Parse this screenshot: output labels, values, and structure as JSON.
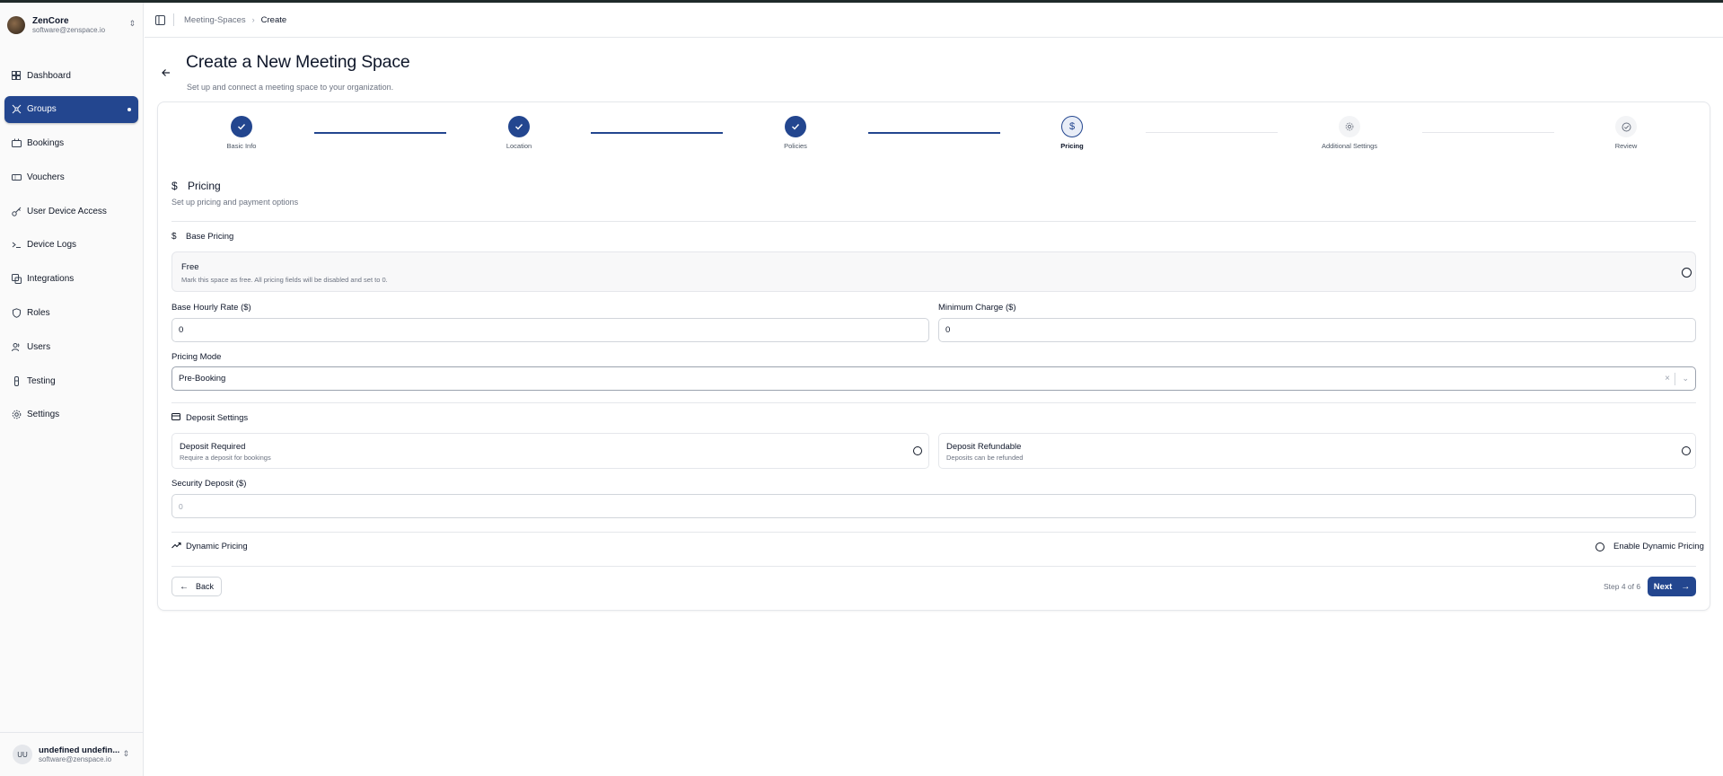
{
  "org": {
    "name": "ZenCore",
    "email": "software@zenspace.io"
  },
  "sidebar": {
    "items": [
      {
        "label": "Dashboard",
        "icon": "dashboard-icon",
        "active": false
      },
      {
        "label": "Groups",
        "icon": "groups-icon",
        "active": true
      },
      {
        "label": "Bookings",
        "icon": "bookings-icon",
        "active": false
      },
      {
        "label": "Vouchers",
        "icon": "vouchers-icon",
        "active": false
      },
      {
        "label": "User Device Access",
        "icon": "key-icon",
        "active": false
      },
      {
        "label": "Device Logs",
        "icon": "terminal-icon",
        "active": false
      },
      {
        "label": "Integrations",
        "icon": "integrations-icon",
        "active": false
      },
      {
        "label": "Roles",
        "icon": "shield-icon",
        "active": false
      },
      {
        "label": "Users",
        "icon": "users-icon",
        "active": false
      },
      {
        "label": "Testing",
        "icon": "flask-icon",
        "active": false
      },
      {
        "label": "Settings",
        "icon": "gear-icon",
        "active": false
      }
    ]
  },
  "user": {
    "initials": "UU",
    "name": "undefined undefin...",
    "email": "software@zenspace.io"
  },
  "breadcrumb": {
    "parent": "Meeting-Spaces",
    "current": "Create"
  },
  "page": {
    "title": "Create a New Meeting Space",
    "subtitle": "Set up and connect a meeting space to your organization."
  },
  "stepper": {
    "steps": [
      {
        "label": "Basic Info",
        "status": "done"
      },
      {
        "label": "Location",
        "status": "done"
      },
      {
        "label": "Policies",
        "status": "done"
      },
      {
        "label": "Pricing",
        "status": "current"
      },
      {
        "label": "Additional Settings",
        "status": "pending"
      },
      {
        "label": "Review",
        "status": "pending"
      }
    ]
  },
  "pricing": {
    "title": "Pricing",
    "subtitle": "Set up pricing and payment options",
    "base_pricing_label": "Base Pricing",
    "free": {
      "title": "Free",
      "description": "Mark this space as free. All pricing fields will be disabled and set to 0."
    },
    "base_hourly_rate": {
      "label": "Base Hourly Rate ($)",
      "value": "0"
    },
    "minimum_charge": {
      "label": "Minimum Charge ($)",
      "value": "0"
    },
    "pricing_mode": {
      "label": "Pricing Mode",
      "value": "Pre-Booking"
    },
    "deposit_settings_label": "Deposit Settings",
    "deposit_required": {
      "title": "Deposit Required",
      "description": "Require a deposit for bookings"
    },
    "deposit_refundable": {
      "title": "Deposit Refundable",
      "description": "Deposits can be refunded"
    },
    "security_deposit": {
      "label": "Security Deposit ($)",
      "placeholder": "0"
    },
    "dynamic_pricing_label": "Dynamic Pricing",
    "enable_dynamic_pricing_label": "Enable Dynamic Pricing"
  },
  "footer": {
    "back_label": "Back",
    "step_text": "Step 4 of 6",
    "next_label": "Next"
  },
  "colors": {
    "accent": "#23468f",
    "border": "#e5e7eb",
    "muted_text": "#6b7280"
  }
}
